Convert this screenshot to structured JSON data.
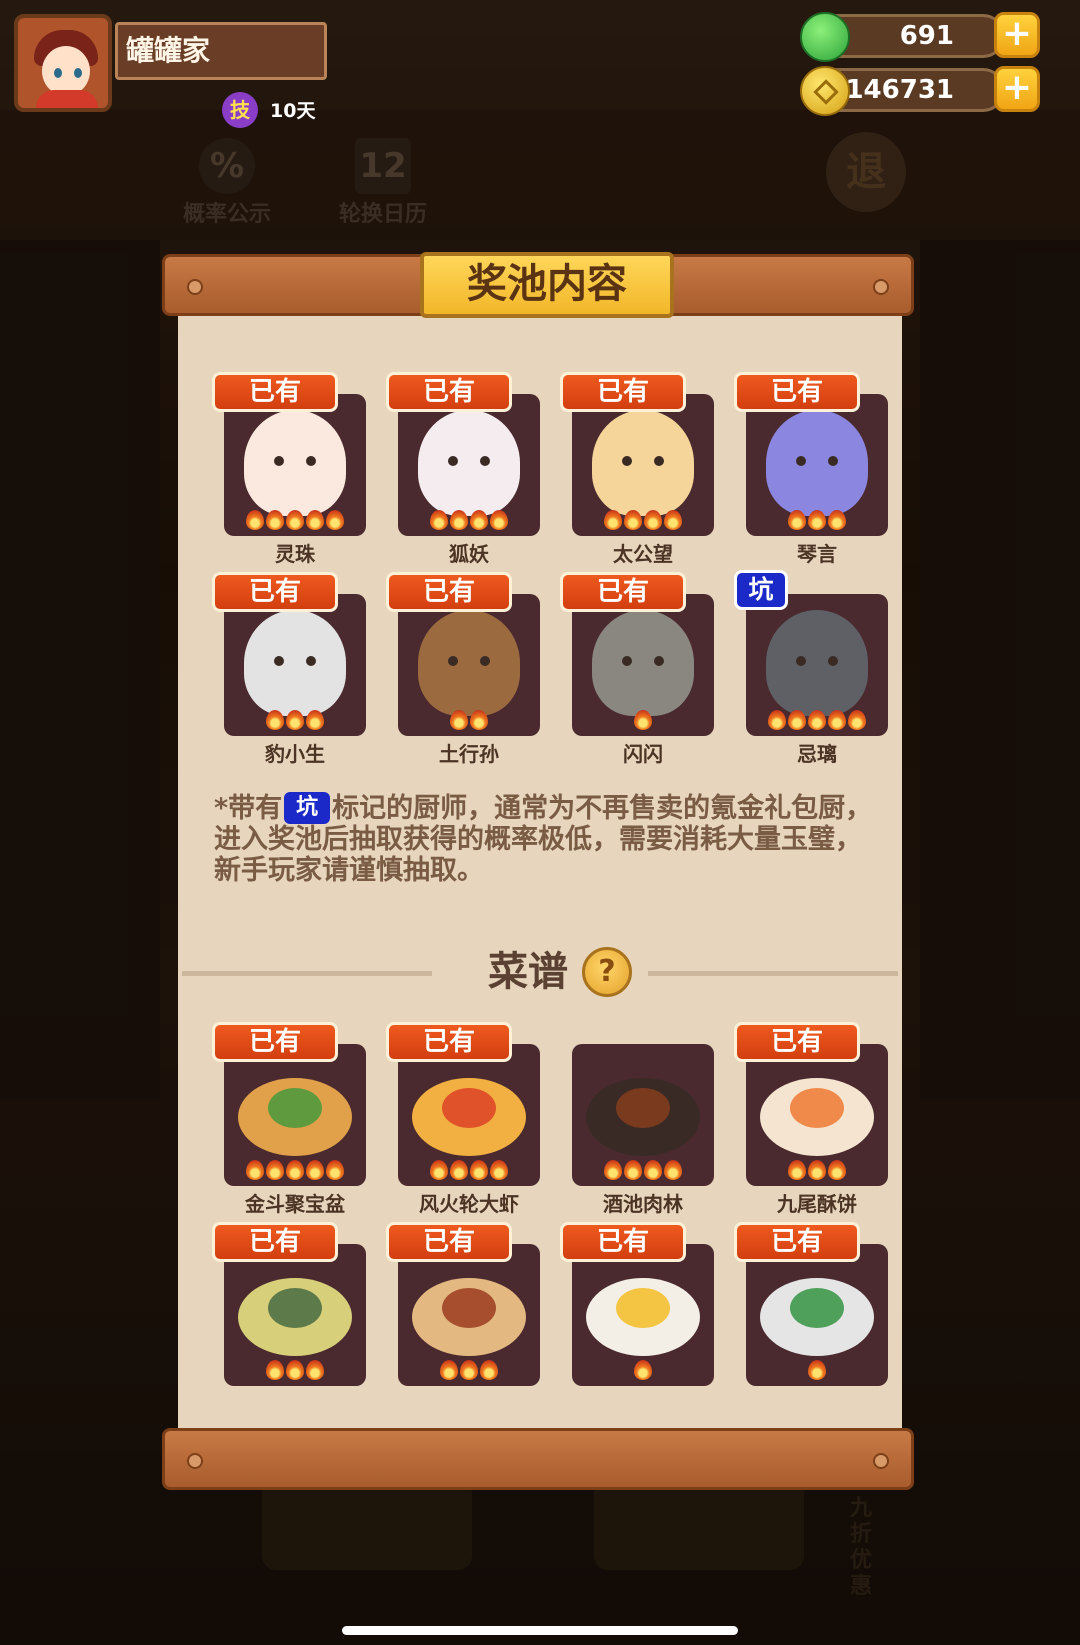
{
  "player": {
    "name": "罐罐家",
    "skill_badge": "技",
    "skill_days": "10天"
  },
  "resources": {
    "jade": "691",
    "coins": "2146731",
    "plus_symbol": "+"
  },
  "background": {
    "probability_label": "概率公示",
    "probability_icon": "%",
    "calendar_label": "轮换日历",
    "calendar_icon": "12",
    "exit_label": "退"
  },
  "modal": {
    "title": "奖池内容",
    "owned_label": "已有",
    "keng_label": "坑",
    "chefs": [
      {
        "name": "灵珠",
        "owned": true,
        "flames": 5,
        "color": "#fbe9e0"
      },
      {
        "name": "狐妖",
        "owned": true,
        "flames": 4,
        "color": "#f4ecef"
      },
      {
        "name": "太公望",
        "owned": true,
        "flames": 4,
        "color": "#f6d59a"
      },
      {
        "name": "琴言",
        "owned": true,
        "flames": 3,
        "color": "#8b86e0"
      },
      {
        "name": "豹小生",
        "owned": true,
        "flames": 3,
        "color": "#e3e3e3"
      },
      {
        "name": "土行孙",
        "owned": true,
        "flames": 2,
        "color": "#9b6a3f"
      },
      {
        "name": "闪闪",
        "owned": true,
        "flames": 1,
        "color": "#8a8680"
      },
      {
        "name": "忌璃",
        "owned": false,
        "keng": true,
        "flames": 5,
        "color": "#5f6066"
      }
    ],
    "note_prefix": "*带有",
    "note_keng": "坑",
    "note_rest": "标记的厨师，通常为不再售卖的氪金礼包厨，进入奖池后抽取获得的概率极低，需要消耗大量玉璧，新手玩家请谨慎抽取。",
    "recipes_title": "菜谱",
    "help_symbol": "?",
    "recipes": [
      {
        "name": "金斗聚宝盆",
        "owned": true,
        "flames": 5,
        "color": "#e1a14a",
        "topping": "#5f9a3e"
      },
      {
        "name": "风火轮大虾",
        "owned": true,
        "flames": 4,
        "color": "#f3b042",
        "topping": "#e0522a"
      },
      {
        "name": "酒池肉林",
        "owned": false,
        "flames": 4,
        "color": "#3a2a26",
        "topping": "#7a3a1e"
      },
      {
        "name": "九尾酥饼",
        "owned": true,
        "flames": 3,
        "color": "#f5e4d0",
        "topping": "#f08a4a"
      },
      {
        "name": "",
        "owned": true,
        "flames": 3,
        "color": "#d7cf79",
        "topping": "#5d7a4a"
      },
      {
        "name": "",
        "owned": true,
        "flames": 3,
        "color": "#e3b981",
        "topping": "#a64e2e"
      },
      {
        "name": "",
        "owned": true,
        "flames": 1,
        "color": "#f4efe6",
        "topping": "#f4c542"
      },
      {
        "name": "",
        "owned": true,
        "flames": 1,
        "color": "#e5e5e5",
        "topping": "#4fa05a"
      }
    ]
  },
  "bottom": {
    "discount_text": "九折优惠"
  }
}
